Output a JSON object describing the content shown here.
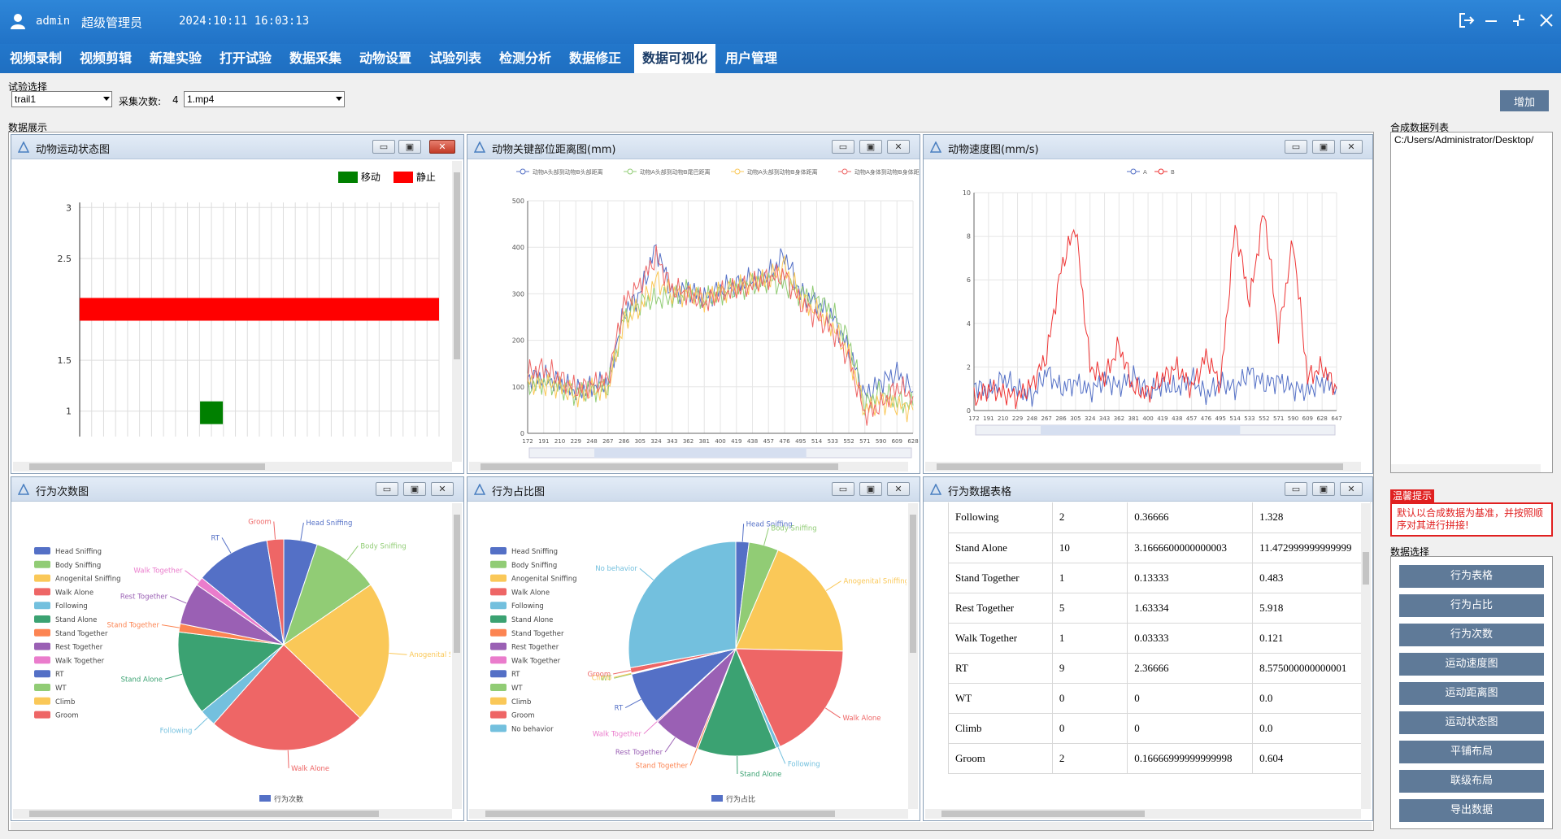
{
  "titlebar": {
    "user": "admin",
    "role": "超级管理员",
    "datetime": "2024:10:11 16:03:13"
  },
  "menu": [
    "视频录制",
    "视频剪辑",
    "新建实验",
    "打开试验",
    "数据采集",
    "动物设置",
    "试验列表",
    "检测分析",
    "数据修正",
    "数据可视化",
    "用户管理"
  ],
  "active_menu": "数据可视化",
  "toolbar": {
    "trial_label": "试验选择",
    "trial_value": "trail1",
    "count_label": "采集次数:",
    "count_value": "4",
    "video_value": "1.mp4",
    "add_label": "增加",
    "display_label": "数据展示",
    "merge_label": "合成数据列表"
  },
  "merge_list": {
    "items": [
      "C:/Users/Administrator/Desktop/"
    ]
  },
  "tip": {
    "label": "温馨提示",
    "text": "默认以合成数据为基准，并按照顺序对其进行拼接!"
  },
  "select": {
    "label": "数据选择",
    "buttons": [
      "行为表格",
      "行为占比",
      "行为次数",
      "运动速度图",
      "运动距离图",
      "运动状态图",
      "平铺布局",
      "联级布局",
      "导出数据"
    ]
  },
  "colors": {
    "blue": "#5470c6",
    "green": "#91cc75",
    "yellow": "#fac858",
    "red": "#ee6666",
    "cyan": "#73c0de",
    "teal": "#3ba272",
    "orange": "#fc8452",
    "purple": "#9a60b4",
    "pink": "#ea7ccc"
  },
  "panels": {
    "state": {
      "title": "动物运动状态图",
      "legend_move": "移动",
      "legend_still": "静止"
    },
    "distance": {
      "title": "动物关键部位距离图(mm)",
      "legend": [
        "动物A头部到动物B头部距离",
        "动物A头部到动物B尾巴距离",
        "动物A头部到动物B身体距离",
        "动物A身体到动物B身体距离"
      ]
    },
    "speed": {
      "title": "动物速度图(mm/s)",
      "legend": [
        "A",
        "B"
      ]
    },
    "counts": {
      "title": "行为次数图",
      "footer": "行为次数"
    },
    "ratio": {
      "title": "行为占比图",
      "footer": "行为占比"
    },
    "table": {
      "title": "行为数据表格"
    }
  },
  "chart_data": [
    {
      "type": "bar",
      "title": "动物运动状态图",
      "series": [
        {
          "name": "移动",
          "points": [
            {
              "x": 11,
              "y": 1
            }
          ]
        },
        {
          "name": "静止",
          "range_x": [
            0,
            30
          ],
          "y": 2
        }
      ],
      "yticks": [
        "1",
        "1.5",
        "2.5",
        "3"
      ],
      "ylim": [
        0.75,
        3.05
      ],
      "grid": true,
      "legend": "top-right"
    },
    {
      "type": "line",
      "title": "动物关键部位距离图(mm)",
      "x_ticks": [
        "172",
        "191",
        "210",
        "229",
        "248",
        "267",
        "286",
        "305",
        "324",
        "343",
        "362",
        "381",
        "400",
        "419",
        "438",
        "457",
        "476",
        "495",
        "514",
        "533",
        "552",
        "571",
        "590",
        "609",
        "628"
      ],
      "yticks": [
        "0",
        "100",
        "200",
        "300",
        "400",
        "500"
      ],
      "ylim": [
        0,
        500
      ],
      "series": [
        {
          "name": "动物A头部到动物B头部距离",
          "values": [
            120,
            120,
            110,
            90,
            100,
            110,
            260,
            300,
            400,
            300,
            310,
            290,
            310,
            320,
            330,
            340,
            385,
            300,
            280,
            250,
            180,
            80,
            110,
            130,
            90
          ]
        },
        {
          "name": "动物A头部到动物B尾巴距离",
          "values": [
            100,
            110,
            100,
            85,
            95,
            100,
            250,
            280,
            290,
            290,
            305,
            285,
            300,
            310,
            320,
            330,
            320,
            300,
            290,
            260,
            200,
            60,
            90,
            70,
            60
          ]
        },
        {
          "name": "动物A头部到动物B身体距离",
          "values": [
            110,
            105,
            100,
            80,
            90,
            95,
            240,
            270,
            330,
            300,
            300,
            290,
            305,
            315,
            325,
            330,
            360,
            290,
            260,
            230,
            170,
            50,
            70,
            60,
            50
          ]
        },
        {
          "name": "动物A身体到动物B身体距离",
          "values": [
            130,
            140,
            120,
            95,
            105,
            115,
            280,
            320,
            380,
            310,
            300,
            280,
            300,
            310,
            320,
            335,
            340,
            280,
            250,
            220,
            160,
            40,
            60,
            100,
            80
          ]
        }
      ],
      "legend": "top"
    },
    {
      "type": "line",
      "title": "动物速度图(mm/s)",
      "x_ticks": [
        "172",
        "191",
        "210",
        "229",
        "248",
        "267",
        "286",
        "305",
        "324",
        "343",
        "362",
        "381",
        "400",
        "419",
        "438",
        "457",
        "476",
        "495",
        "514",
        "533",
        "552",
        "571",
        "590",
        "609",
        "628",
        "647"
      ],
      "yticks": [
        "0",
        "2",
        "4",
        "6",
        "8",
        "10"
      ],
      "ylim": [
        0,
        10
      ],
      "series": [
        {
          "name": "A",
          "values": [
            1.2,
            0.8,
            1.5,
            1.0,
            0.6,
            1.8,
            1.0,
            1.3,
            0.9,
            1.4,
            1.1,
            1.6,
            0.8,
            1.2,
            1.0,
            1.5,
            0.7,
            1.3,
            1.0,
            1.8,
            1.2,
            1.4,
            1.0,
            0.9,
            1.3,
            1.1
          ]
        },
        {
          "name": "B",
          "values": [
            0.5,
            1.0,
            0.8,
            0.6,
            1.2,
            2.5,
            6.5,
            8.5,
            2.0,
            1.5,
            3.0,
            1.0,
            0.8,
            1.5,
            2.0,
            1.0,
            2.5,
            1.2,
            8.5,
            5.0,
            9.2,
            3.5,
            7.8,
            1.5,
            2.0,
            1.0
          ]
        }
      ],
      "legend": "top"
    },
    {
      "type": "pie",
      "title": "行为次数图",
      "categories": [
        "Head Sniffing",
        "Body Sniffing",
        "Anogenital Sniffing",
        "Walk Alone",
        "Following",
        "Stand Alone",
        "Stand Together",
        "Rest Together",
        "Walk Together",
        "RT",
        "WT",
        "Climb",
        "Groom"
      ],
      "values": [
        4,
        8,
        17,
        19,
        2,
        10,
        1,
        5,
        1,
        9,
        0,
        0,
        2
      ]
    },
    {
      "type": "pie",
      "title": "行为占比图",
      "categories": [
        "Head Sniffing",
        "Body Sniffing",
        "Anogenital Sniffing",
        "Walk Alone",
        "Following",
        "Stand Alone",
        "Stand Together",
        "Rest Together",
        "Walk Together",
        "RT",
        "WT",
        "Climb",
        "Groom",
        "No behavior"
      ],
      "values": [
        2.0,
        4.5,
        19.0,
        18.0,
        0.6,
        12.0,
        0.3,
        7.0,
        0.2,
        8.0,
        0.1,
        0.1,
        0.8,
        28.0
      ]
    },
    {
      "type": "table",
      "title": "行为数据表格",
      "rows": [
        [
          "Following",
          "2",
          "0.36666",
          "1.328"
        ],
        [
          "Stand Alone",
          "10",
          "3.1666600000000003",
          "11.472999999999999"
        ],
        [
          "Stand Together",
          "1",
          "0.13333",
          "0.483"
        ],
        [
          "Rest Together",
          "5",
          "1.63334",
          "5.918"
        ],
        [
          "Walk Together",
          "1",
          "0.03333",
          "0.121"
        ],
        [
          "RT",
          "9",
          "2.36666",
          "8.575000000000001"
        ],
        [
          "WT",
          "0",
          "0",
          "0.0"
        ],
        [
          "Climb",
          "0",
          "0",
          "0.0"
        ],
        [
          "Groom",
          "2",
          "0.16666999999999998",
          "0.604"
        ]
      ]
    }
  ]
}
